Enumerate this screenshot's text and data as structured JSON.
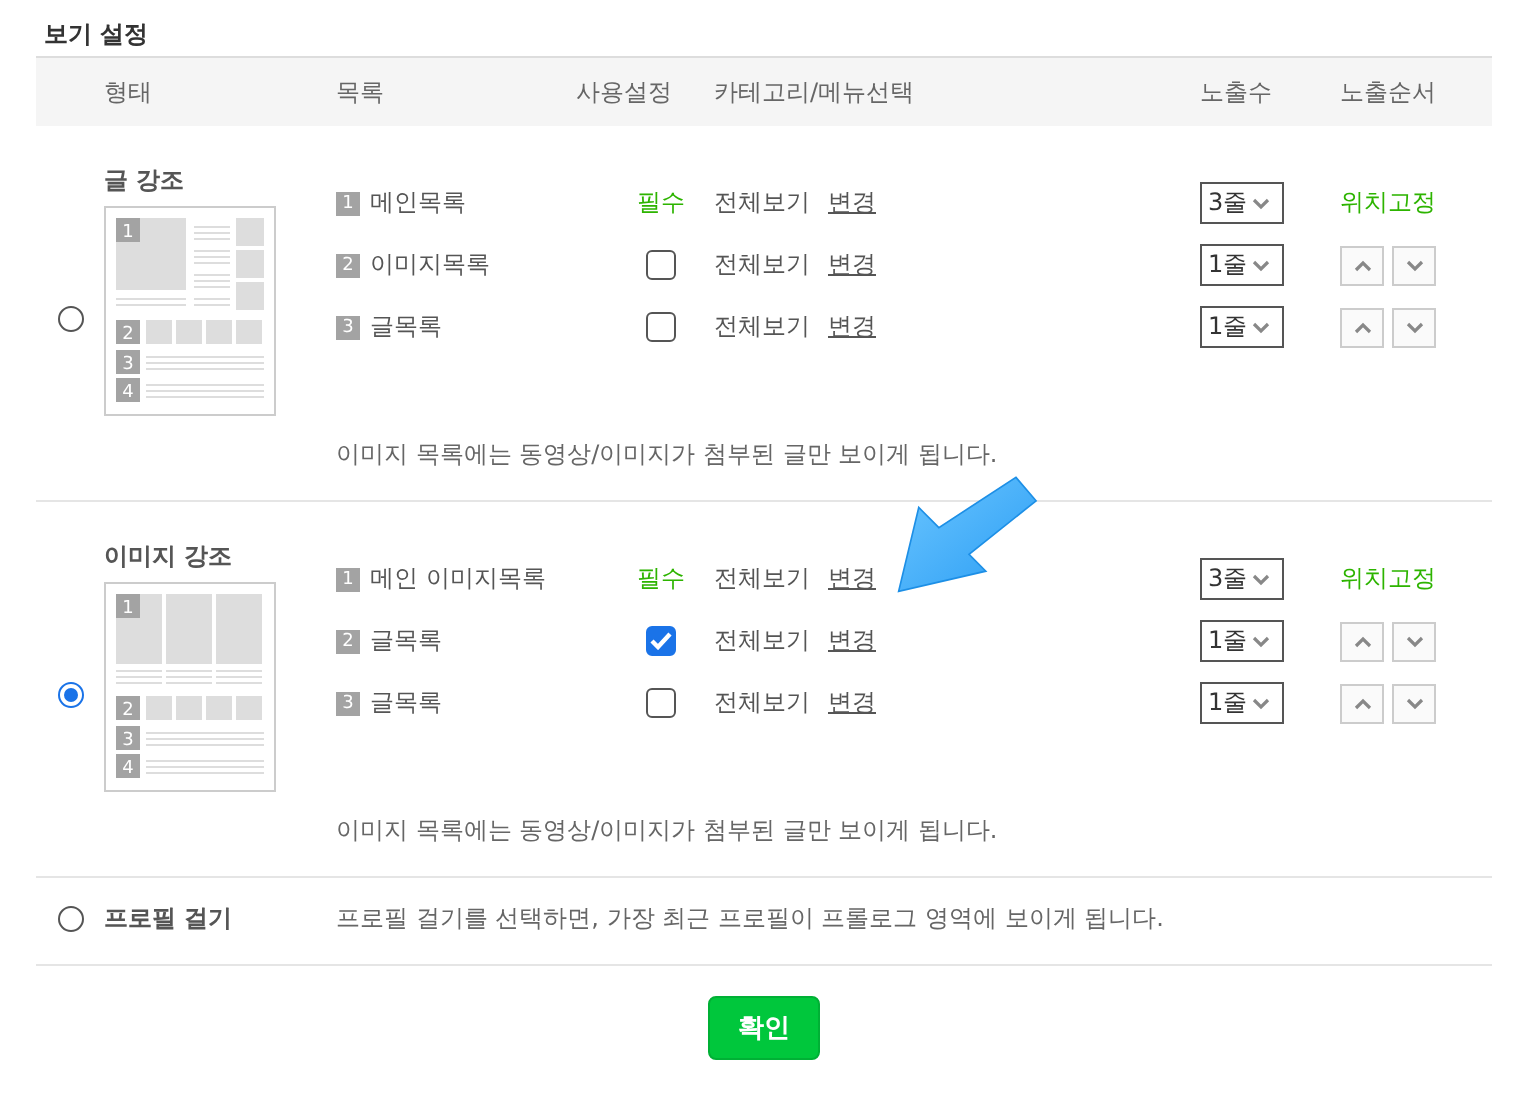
{
  "title": "보기 설정",
  "columns": [
    "형태",
    "목록",
    "사용설정",
    "카테고리/메뉴선택",
    "노출수",
    "노출순서"
  ],
  "layouts": [
    {
      "kind": "text",
      "name": "글 강조",
      "selected": false,
      "preview_numbers": [
        "1",
        "2",
        "3",
        "4"
      ],
      "note": "이미지 목록에는 동영상/이미지가 첨부된 글만 보이게 됩니다.",
      "rows": [
        {
          "kind": "main",
          "number": "1",
          "name": "메인목록",
          "required_label": "필수",
          "category": "전체보기",
          "change": "변경",
          "count": "3줄",
          "order_label": "위치고정"
        },
        {
          "kind": "option",
          "number": "2",
          "name": "이미지목록",
          "checked": false,
          "category": "전체보기",
          "change": "변경",
          "count": "1줄"
        },
        {
          "kind": "option",
          "number": "3",
          "name": "글목록",
          "checked": false,
          "category": "전체보기",
          "change": "변경",
          "count": "1줄"
        }
      ]
    },
    {
      "kind": "image",
      "name": "이미지 강조",
      "selected": true,
      "preview_numbers": [
        "1",
        "2",
        "3",
        "4"
      ],
      "note": "이미지 목록에는 동영상/이미지가 첨부된 글만 보이게 됩니다.",
      "rows": [
        {
          "kind": "main",
          "number": "1",
          "name": "메인 이미지목록",
          "required_label": "필수",
          "category": "전체보기",
          "change": "변경",
          "count": "3줄",
          "order_label": "위치고정"
        },
        {
          "kind": "option",
          "number": "2",
          "name": "글목록",
          "checked": true,
          "category": "전체보기",
          "change": "변경",
          "count": "1줄"
        },
        {
          "kind": "option",
          "number": "3",
          "name": "글목록",
          "checked": false,
          "category": "전체보기",
          "change": "변경",
          "count": "1줄"
        }
      ]
    }
  ],
  "profile": {
    "name": "프로필 걸기",
    "selected": false,
    "description": "프로필 걸기를 선택하면, 가장 최근 프로필이 프롤로그 영역에 보이게 됩니다."
  },
  "confirm": "확인"
}
